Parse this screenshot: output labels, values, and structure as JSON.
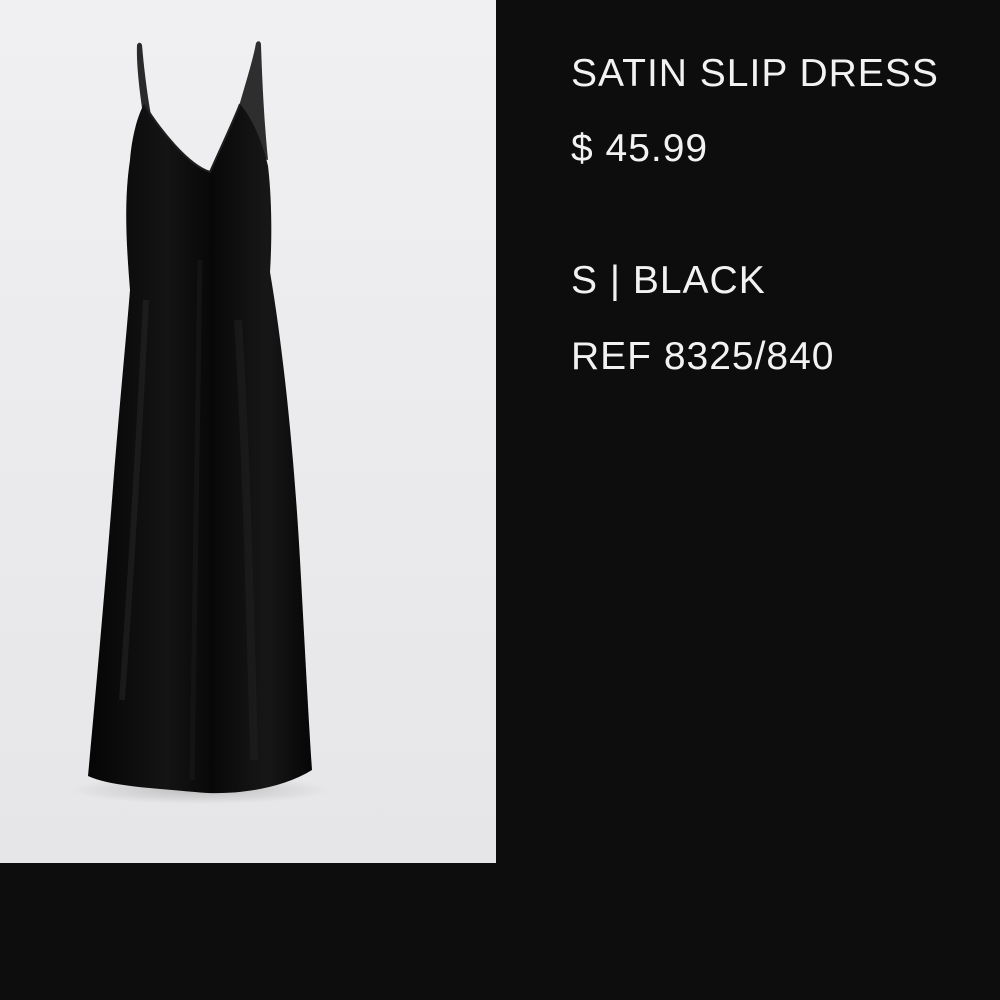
{
  "product": {
    "name": "SATIN SLIP DRESS",
    "price": "$ 45.99",
    "variant": "S | BLACK",
    "reference": "REF 8325/840"
  },
  "colors": {
    "background": "#0d0d0d",
    "text": "#f2f2f2",
    "photo_background": "#ededef",
    "dress": "#0b0b0b"
  }
}
